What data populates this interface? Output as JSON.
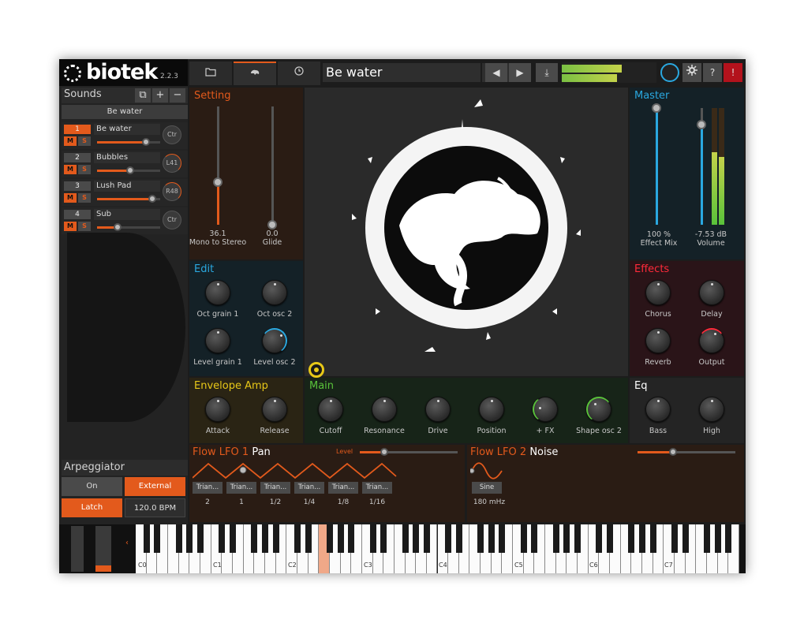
{
  "app": {
    "logo_text": "biotek",
    "version": "2.2.3"
  },
  "sounds": {
    "title": "Sounds",
    "buttons": [
      "⧉",
      "+",
      "−"
    ],
    "preset_name": "Be water",
    "items": [
      {
        "num": "1",
        "name": "Be water",
        "knob": "Ctr",
        "level": 0.78,
        "mute": "M",
        "solo": "S"
      },
      {
        "num": "2",
        "name": "Bubbles",
        "knob": "L41",
        "level": 0.52,
        "mute": "M",
        "solo": "S"
      },
      {
        "num": "3",
        "name": "Lush Pad",
        "knob": "R48",
        "level": 0.88,
        "mute": "M",
        "solo": "S"
      },
      {
        "num": "4",
        "name": "Sub",
        "knob": "Ctr",
        "level": 0.33,
        "mute": "M",
        "solo": "S"
      }
    ]
  },
  "arpeggiator": {
    "title": "Arpeggiator",
    "on_label": "On",
    "external_label": "External",
    "latch_label": "Latch",
    "bpm": "120.0 BPM"
  },
  "toolbar": {
    "tab_icons": [
      "folder-icon",
      "tree-icon",
      "clock-icon"
    ],
    "preset_title": "Be water",
    "prev_label": "◀",
    "next_label": "▶",
    "save_label": "⤓",
    "help_label": "?",
    "alert_label": "!",
    "meter_levels": [
      0.63,
      0.58
    ]
  },
  "setting": {
    "title": "Setting",
    "mono_to_stereo_value": "36.1",
    "mono_to_stereo_label": "Mono to Stereo",
    "mono_to_stereo_level": 0.36,
    "glide_value": "0.0",
    "glide_label": "Glide",
    "glide_level": 0.0
  },
  "edit": {
    "title": "Edit",
    "knobs": [
      "Oct grain 1",
      "Oct osc 2",
      "Level grain 1",
      "Level osc 2"
    ]
  },
  "master": {
    "title": "Master",
    "effect_mix_value": "100 %",
    "effect_mix_label": "Effect Mix",
    "effect_mix_level": 1.0,
    "volume_value": "-7.53 dB",
    "volume_label": "Volume",
    "volume_level": 0.86
  },
  "effects": {
    "title": "Effects",
    "knobs": [
      "Chorus",
      "Delay",
      "Reverb",
      "Output"
    ]
  },
  "envelope": {
    "title": "Envelope Amp",
    "knobs": [
      "Attack",
      "Release"
    ]
  },
  "main": {
    "title": "Main",
    "knobs": [
      "Cutoff",
      "Resonance",
      "Drive",
      "Position",
      "+ FX",
      "Shape osc 2"
    ]
  },
  "eq": {
    "title": "Eq",
    "knobs": [
      "Bass",
      "High"
    ]
  },
  "lfo1": {
    "title_prefix": "Flow LFO 1",
    "target": "Pan",
    "level_label": "Level",
    "level": 0.25,
    "buttons": [
      "Trian...",
      "Trian...",
      "Trian...",
      "Trian...",
      "Trian...",
      "Trian..."
    ],
    "values": [
      "2",
      "1",
      "1/2",
      "1/4",
      "1/8",
      "1/16"
    ]
  },
  "lfo2": {
    "title_prefix": "Flow LFO 2",
    "target": "Noise",
    "level": 0.36,
    "button": "Sine",
    "value": "180 mHz"
  },
  "keyboard": {
    "octaves": [
      "C0",
      "C1",
      "C2",
      "C3",
      "C4",
      "C5",
      "C6",
      "C7"
    ]
  },
  "colors": {
    "accent": "#e35a1c",
    "blue": "#2aa8e0",
    "green": "#59c23a"
  }
}
